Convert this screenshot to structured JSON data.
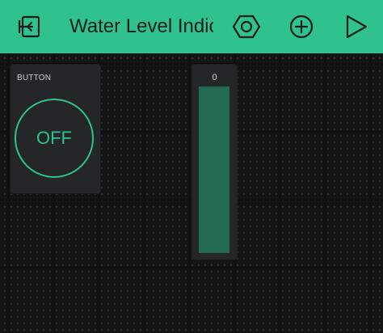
{
  "app": {
    "title": "Water Level Indica",
    "accent": "#2fc28c"
  },
  "toolbar": {
    "back_icon": "exit-panel-icon",
    "settings_icon": "hexagon-nut-icon",
    "add_icon": "plus-circle-icon",
    "play_icon": "play-triangle-icon"
  },
  "widgets": {
    "button": {
      "label": "BUTTON",
      "state": "OFF"
    },
    "level": {
      "value": "0",
      "fill_fraction": 1.0,
      "fill_color": "#236b57"
    }
  }
}
